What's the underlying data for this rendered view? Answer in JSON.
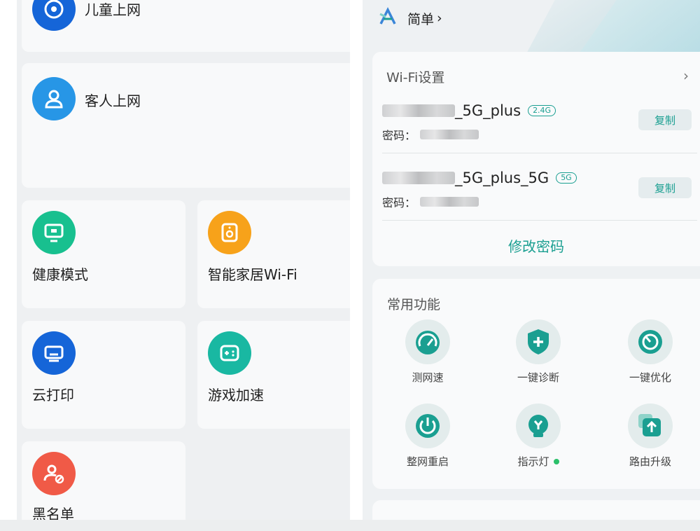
{
  "left": {
    "tiles": [
      {
        "label": "儿童上网",
        "icon": "child-face-icon",
        "color": "#1565d8"
      },
      {
        "label": "客人上网",
        "icon": "guest-user-icon",
        "color": "#2796e6"
      },
      {
        "label": "健康模式",
        "icon": "monitor-icon",
        "color": "#18c08f"
      },
      {
        "label": "智能家居Wi-Fi",
        "icon": "smart-home-device-icon",
        "color": "#f7a21a"
      },
      {
        "label": "云打印",
        "icon": "printer-icon",
        "color": "#1565d8"
      },
      {
        "label": "游戏加速",
        "icon": "gamepad-icon",
        "color": "#19b8a2"
      },
      {
        "label": "黑名单",
        "icon": "blocked-user-icon",
        "color": "#f05a47"
      }
    ]
  },
  "right": {
    "mode": {
      "label": "简单",
      "chevron": "›"
    },
    "wifi": {
      "title": "Wi-Fi设置",
      "chevron": "›",
      "networks": [
        {
          "ssid_suffix": "_5G_plus",
          "band": "2.4G",
          "password_label": "密码：",
          "copy_label": "复制"
        },
        {
          "ssid_suffix": "_5G_plus_5G",
          "band": "5G",
          "password_label": "密码：",
          "copy_label": "复制"
        }
      ],
      "change_password": "修改密码"
    },
    "functions": {
      "title": "常用功能",
      "items": [
        {
          "label": "测网速",
          "icon": "speedometer-icon"
        },
        {
          "label": "一键诊断",
          "icon": "shield-plus-icon"
        },
        {
          "label": "一键优化",
          "icon": "optimize-dial-icon"
        },
        {
          "label": "整网重启",
          "icon": "power-icon"
        },
        {
          "label": "指示灯",
          "icon": "indicator-light-icon",
          "status": "on"
        },
        {
          "label": "路由升级",
          "icon": "upgrade-arrow-icon"
        }
      ]
    }
  },
  "colors": {
    "accent": "#1a9f91",
    "indicator_on": "#2bc06a"
  }
}
